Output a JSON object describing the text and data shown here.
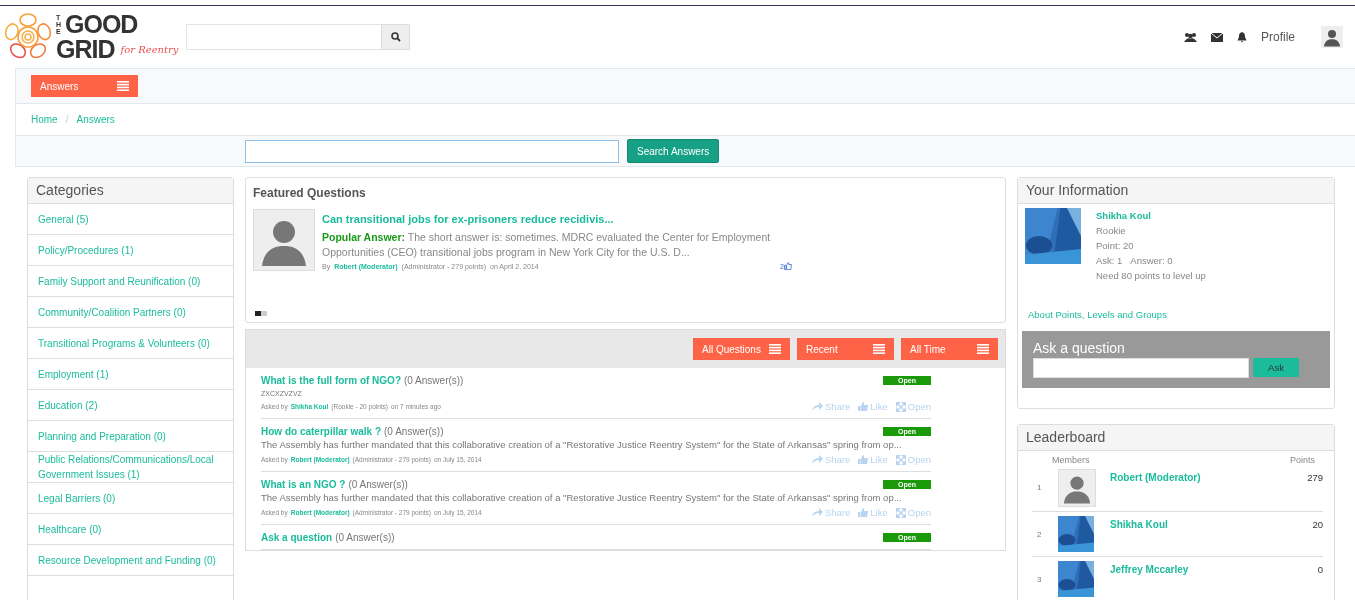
{
  "header": {
    "logo": {
      "the": "THE",
      "good": "GOOD",
      "grid": "GRID",
      "tagline": "for Reentry"
    },
    "profile_label": "Profile"
  },
  "nav": {
    "menu_button": "Answers"
  },
  "breadcrumb": {
    "items": [
      "Home",
      "Answers"
    ],
    "separator": "/"
  },
  "answer_search": {
    "button": "Search Answers"
  },
  "categories": {
    "title": "Categories",
    "items": [
      "General (5)",
      "Policy/Procedures (1)",
      "Family Support and Reunification (0)",
      "Community/Coalition Partners (0)",
      "Transitional Programs & Volunteers (0)",
      "Employment (1)",
      "Education (2)",
      "Planning and Preparation (0)",
      "Public Relations/Communications/Local Government Issues (1)",
      "Legal Barriers (0)",
      "Healthcare (0)",
      "Resource Development and Funding (0)"
    ]
  },
  "featured": {
    "title": "Featured Questions",
    "question": {
      "title": "Can transitional jobs for ex-prisoners reduce recidivis...",
      "answer": "**Popular Answer:** The short answer is: sometimes. MDRC evaluated the Center for Employment Opportunities (CEO) transitional jobs program in New York City for the U.S. D...",
      "by": "By",
      "author": "Robert (Moderator)",
      "role": "(Administrator - 279 points)",
      "date": "on April 2, 2014",
      "likes": "2"
    },
    "pager": [
      {
        "selected": true
      },
      {
        "selected": false
      }
    ]
  },
  "filters": [
    "All Questions",
    "Recent",
    "All Time"
  ],
  "questions": [
    {
      "title": "What is the full form of NGO?",
      "answers": "(0 Answer(s))",
      "body": "ZXCXZVZVZ",
      "small_body": true,
      "asked_by": "Asked by",
      "author": "Shikha Koul",
      "role": "(Rookie - 20 points)",
      "date": "on 7 minutes ago",
      "status": "Open",
      "actions": [
        "Share",
        "Like",
        "Open"
      ]
    },
    {
      "title": "How do caterpillar walk ?",
      "answers": "(0 Answer(s))",
      "body": "The Assembly has further mandated that this collaborative creation of a \"Restorative Justice Reentry System\" for the State of Arkansas\" spring from op...",
      "small_body": false,
      "asked_by": "Asked by",
      "author": "Robert (Moderator)",
      "role": "(Administrator - 279 points)",
      "date": "on July 15, 2014",
      "status": "Open",
      "actions": [
        "Share",
        "Like",
        "Open"
      ]
    },
    {
      "title": "What is an NGO ?",
      "answers": "(0 Answer(s))",
      "body": "The Assembly has further mandated that this collaborative creation of a \"Restorative Justice Reentry System\" for the State of Arkansas\" spring from op...",
      "small_body": false,
      "asked_by": "Asked by",
      "author": "Robert (Moderator)",
      "role": "(Administrator - 279 points)",
      "date": "on July 15, 2014",
      "status": "Open",
      "actions": [
        "Share",
        "Like",
        "Open"
      ]
    },
    {
      "title": "Ask a question",
      "answers": "(0 Answer(s))",
      "status": "Open"
    }
  ],
  "your_info": {
    "title": "Your Information",
    "name": "Shikha Koul",
    "level": "Rookie",
    "points": "Point: 20",
    "ask": "Ask: 1",
    "answer": "Answer: 0",
    "need": "Need 80 points to level up",
    "link": "About Points, Levels and Groups"
  },
  "ask_box": {
    "title": "Ask a question",
    "button": "Ask"
  },
  "leaderboard": {
    "title": "Leaderboard",
    "columns": [
      "Members",
      "Points"
    ],
    "rows": [
      {
        "rank": "1",
        "kind": "silhouette",
        "name": "Robert (Moderator)",
        "points": "279"
      },
      {
        "rank": "2",
        "kind": "picture",
        "name": "Shikha Koul",
        "points": "20"
      },
      {
        "rank": "3",
        "kind": "picture",
        "name": "Jeffrey Mccarley",
        "points": "0"
      }
    ]
  }
}
